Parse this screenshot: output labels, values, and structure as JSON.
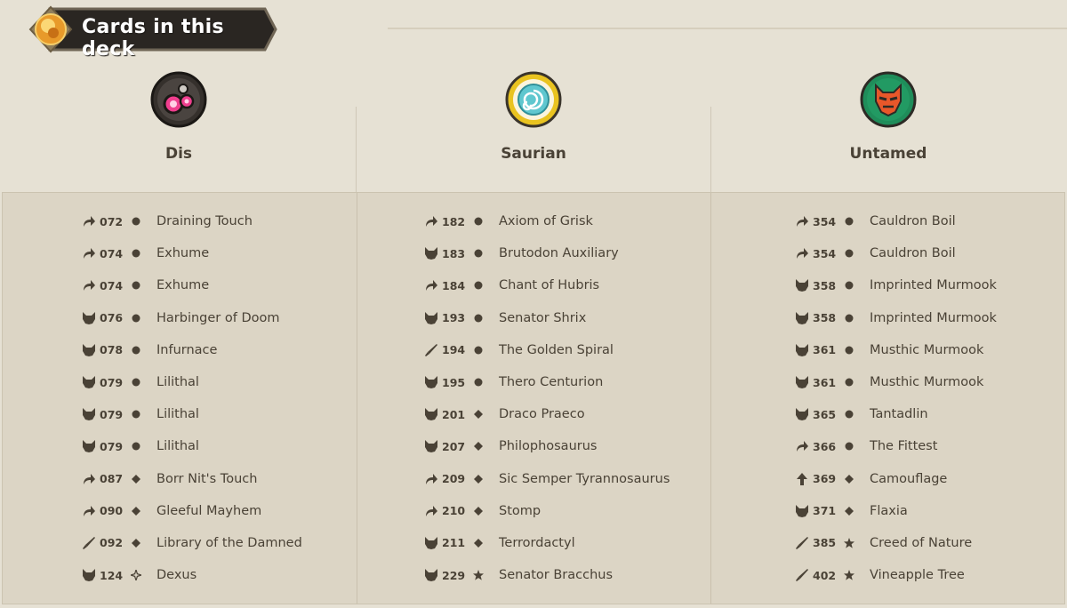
{
  "header": {
    "title": "Cards in this deck"
  },
  "houses": [
    {
      "name": "Dis",
      "emblem": "dis-emblem-icon",
      "cards": [
        {
          "type": "action-icon",
          "number": "072",
          "rarity": "common",
          "name": "Draining Touch"
        },
        {
          "type": "action-icon",
          "number": "074",
          "rarity": "common",
          "name": "Exhume"
        },
        {
          "type": "action-icon",
          "number": "074",
          "rarity": "common",
          "name": "Exhume"
        },
        {
          "type": "creature-icon",
          "number": "076",
          "rarity": "common",
          "name": "Harbinger of Doom"
        },
        {
          "type": "creature-icon",
          "number": "078",
          "rarity": "common",
          "name": "Infurnace"
        },
        {
          "type": "creature-icon",
          "number": "079",
          "rarity": "common",
          "name": "Lilithal"
        },
        {
          "type": "creature-icon",
          "number": "079",
          "rarity": "common",
          "name": "Lilithal"
        },
        {
          "type": "creature-icon",
          "number": "079",
          "rarity": "common",
          "name": "Lilithal"
        },
        {
          "type": "action-icon",
          "number": "087",
          "rarity": "uncommon",
          "name": "Borr Nit's Touch"
        },
        {
          "type": "action-icon",
          "number": "090",
          "rarity": "uncommon",
          "name": "Gleeful Mayhem"
        },
        {
          "type": "artifact-icon",
          "number": "092",
          "rarity": "uncommon",
          "name": "Library of the Damned"
        },
        {
          "type": "creature-icon",
          "number": "124",
          "rarity": "special",
          "name": "Dexus"
        }
      ]
    },
    {
      "name": "Saurian",
      "emblem": "saurian-emblem-icon",
      "cards": [
        {
          "type": "action-icon",
          "number": "182",
          "rarity": "common",
          "name": "Axiom of Grisk"
        },
        {
          "type": "creature-icon",
          "number": "183",
          "rarity": "common",
          "name": "Brutodon Auxiliary"
        },
        {
          "type": "action-icon",
          "number": "184",
          "rarity": "common",
          "name": "Chant of Hubris"
        },
        {
          "type": "creature-icon",
          "number": "193",
          "rarity": "common",
          "name": "Senator Shrix"
        },
        {
          "type": "artifact-icon",
          "number": "194",
          "rarity": "common",
          "name": "The Golden Spiral"
        },
        {
          "type": "creature-icon",
          "number": "195",
          "rarity": "common",
          "name": "Thero Centurion"
        },
        {
          "type": "creature-icon",
          "number": "201",
          "rarity": "uncommon",
          "name": "Draco Praeco"
        },
        {
          "type": "creature-icon",
          "number": "207",
          "rarity": "uncommon",
          "name": "Philophosaurus"
        },
        {
          "type": "action-icon",
          "number": "209",
          "rarity": "uncommon",
          "name": "Sic Semper Tyrannosaurus"
        },
        {
          "type": "action-icon",
          "number": "210",
          "rarity": "uncommon",
          "name": "Stomp"
        },
        {
          "type": "creature-icon",
          "number": "211",
          "rarity": "uncommon",
          "name": "Terrordactyl"
        },
        {
          "type": "creature-icon",
          "number": "229",
          "rarity": "rare",
          "name": "Senator Bracchus"
        }
      ]
    },
    {
      "name": "Untamed",
      "emblem": "untamed-emblem-icon",
      "cards": [
        {
          "type": "action-icon",
          "number": "354",
          "rarity": "common",
          "name": "Cauldron Boil"
        },
        {
          "type": "action-icon",
          "number": "354",
          "rarity": "common",
          "name": "Cauldron Boil"
        },
        {
          "type": "creature-icon",
          "number": "358",
          "rarity": "common",
          "name": "Imprinted Murmook"
        },
        {
          "type": "creature-icon",
          "number": "358",
          "rarity": "common",
          "name": "Imprinted Murmook"
        },
        {
          "type": "creature-icon",
          "number": "361",
          "rarity": "common",
          "name": "Musthic Murmook"
        },
        {
          "type": "creature-icon",
          "number": "361",
          "rarity": "common",
          "name": "Musthic Murmook"
        },
        {
          "type": "creature-icon",
          "number": "365",
          "rarity": "common",
          "name": "Tantadlin"
        },
        {
          "type": "action-icon",
          "number": "366",
          "rarity": "common",
          "name": "The Fittest"
        },
        {
          "type": "upgrade-icon",
          "number": "369",
          "rarity": "uncommon",
          "name": "Camouflage"
        },
        {
          "type": "creature-icon",
          "number": "371",
          "rarity": "uncommon",
          "name": "Flaxia"
        },
        {
          "type": "artifact-icon",
          "number": "385",
          "rarity": "rare",
          "name": "Creed of Nature"
        },
        {
          "type": "artifact-icon",
          "number": "402",
          "rarity": "rare",
          "name": "Vineapple Tree"
        }
      ]
    }
  ]
}
